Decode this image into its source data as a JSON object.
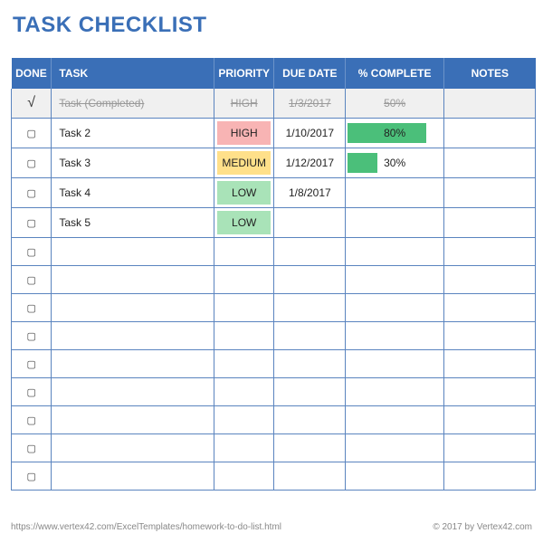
{
  "title": "TASK CHECKLIST",
  "columns": {
    "done": "DONE",
    "task": "TASK",
    "priority": "PRIORITY",
    "due": "DUE DATE",
    "pct": "% COMPLETE",
    "notes": "NOTES"
  },
  "glyphs": {
    "checked": "√",
    "unchecked": "▢"
  },
  "rows": [
    {
      "done": true,
      "task": "Task (Completed)",
      "priority": "HIGH",
      "due": "1/3/2017",
      "pct": 50,
      "notes": ""
    },
    {
      "done": false,
      "task": "Task 2",
      "priority": "HIGH",
      "due": "1/10/2017",
      "pct": 80,
      "notes": ""
    },
    {
      "done": false,
      "task": "Task 3",
      "priority": "MEDIUM",
      "due": "1/12/2017",
      "pct": 30,
      "notes": ""
    },
    {
      "done": false,
      "task": "Task 4",
      "priority": "LOW",
      "due": "1/8/2017",
      "pct": null,
      "notes": ""
    },
    {
      "done": false,
      "task": "Task 5",
      "priority": "LOW",
      "due": "",
      "pct": null,
      "notes": ""
    },
    {
      "done": false,
      "task": "",
      "priority": "",
      "due": "",
      "pct": null,
      "notes": ""
    },
    {
      "done": false,
      "task": "",
      "priority": "",
      "due": "",
      "pct": null,
      "notes": ""
    },
    {
      "done": false,
      "task": "",
      "priority": "",
      "due": "",
      "pct": null,
      "notes": ""
    },
    {
      "done": false,
      "task": "",
      "priority": "",
      "due": "",
      "pct": null,
      "notes": ""
    },
    {
      "done": false,
      "task": "",
      "priority": "",
      "due": "",
      "pct": null,
      "notes": ""
    },
    {
      "done": false,
      "task": "",
      "priority": "",
      "due": "",
      "pct": null,
      "notes": ""
    },
    {
      "done": false,
      "task": "",
      "priority": "",
      "due": "",
      "pct": null,
      "notes": ""
    },
    {
      "done": false,
      "task": "",
      "priority": "",
      "due": "",
      "pct": null,
      "notes": ""
    },
    {
      "done": false,
      "task": "",
      "priority": "",
      "due": "",
      "pct": null,
      "notes": ""
    }
  ],
  "footer": {
    "url": "https://www.vertex42.com/ExcelTemplates/homework-to-do-list.html",
    "copyright": "© 2017 by Vertex42.com"
  }
}
